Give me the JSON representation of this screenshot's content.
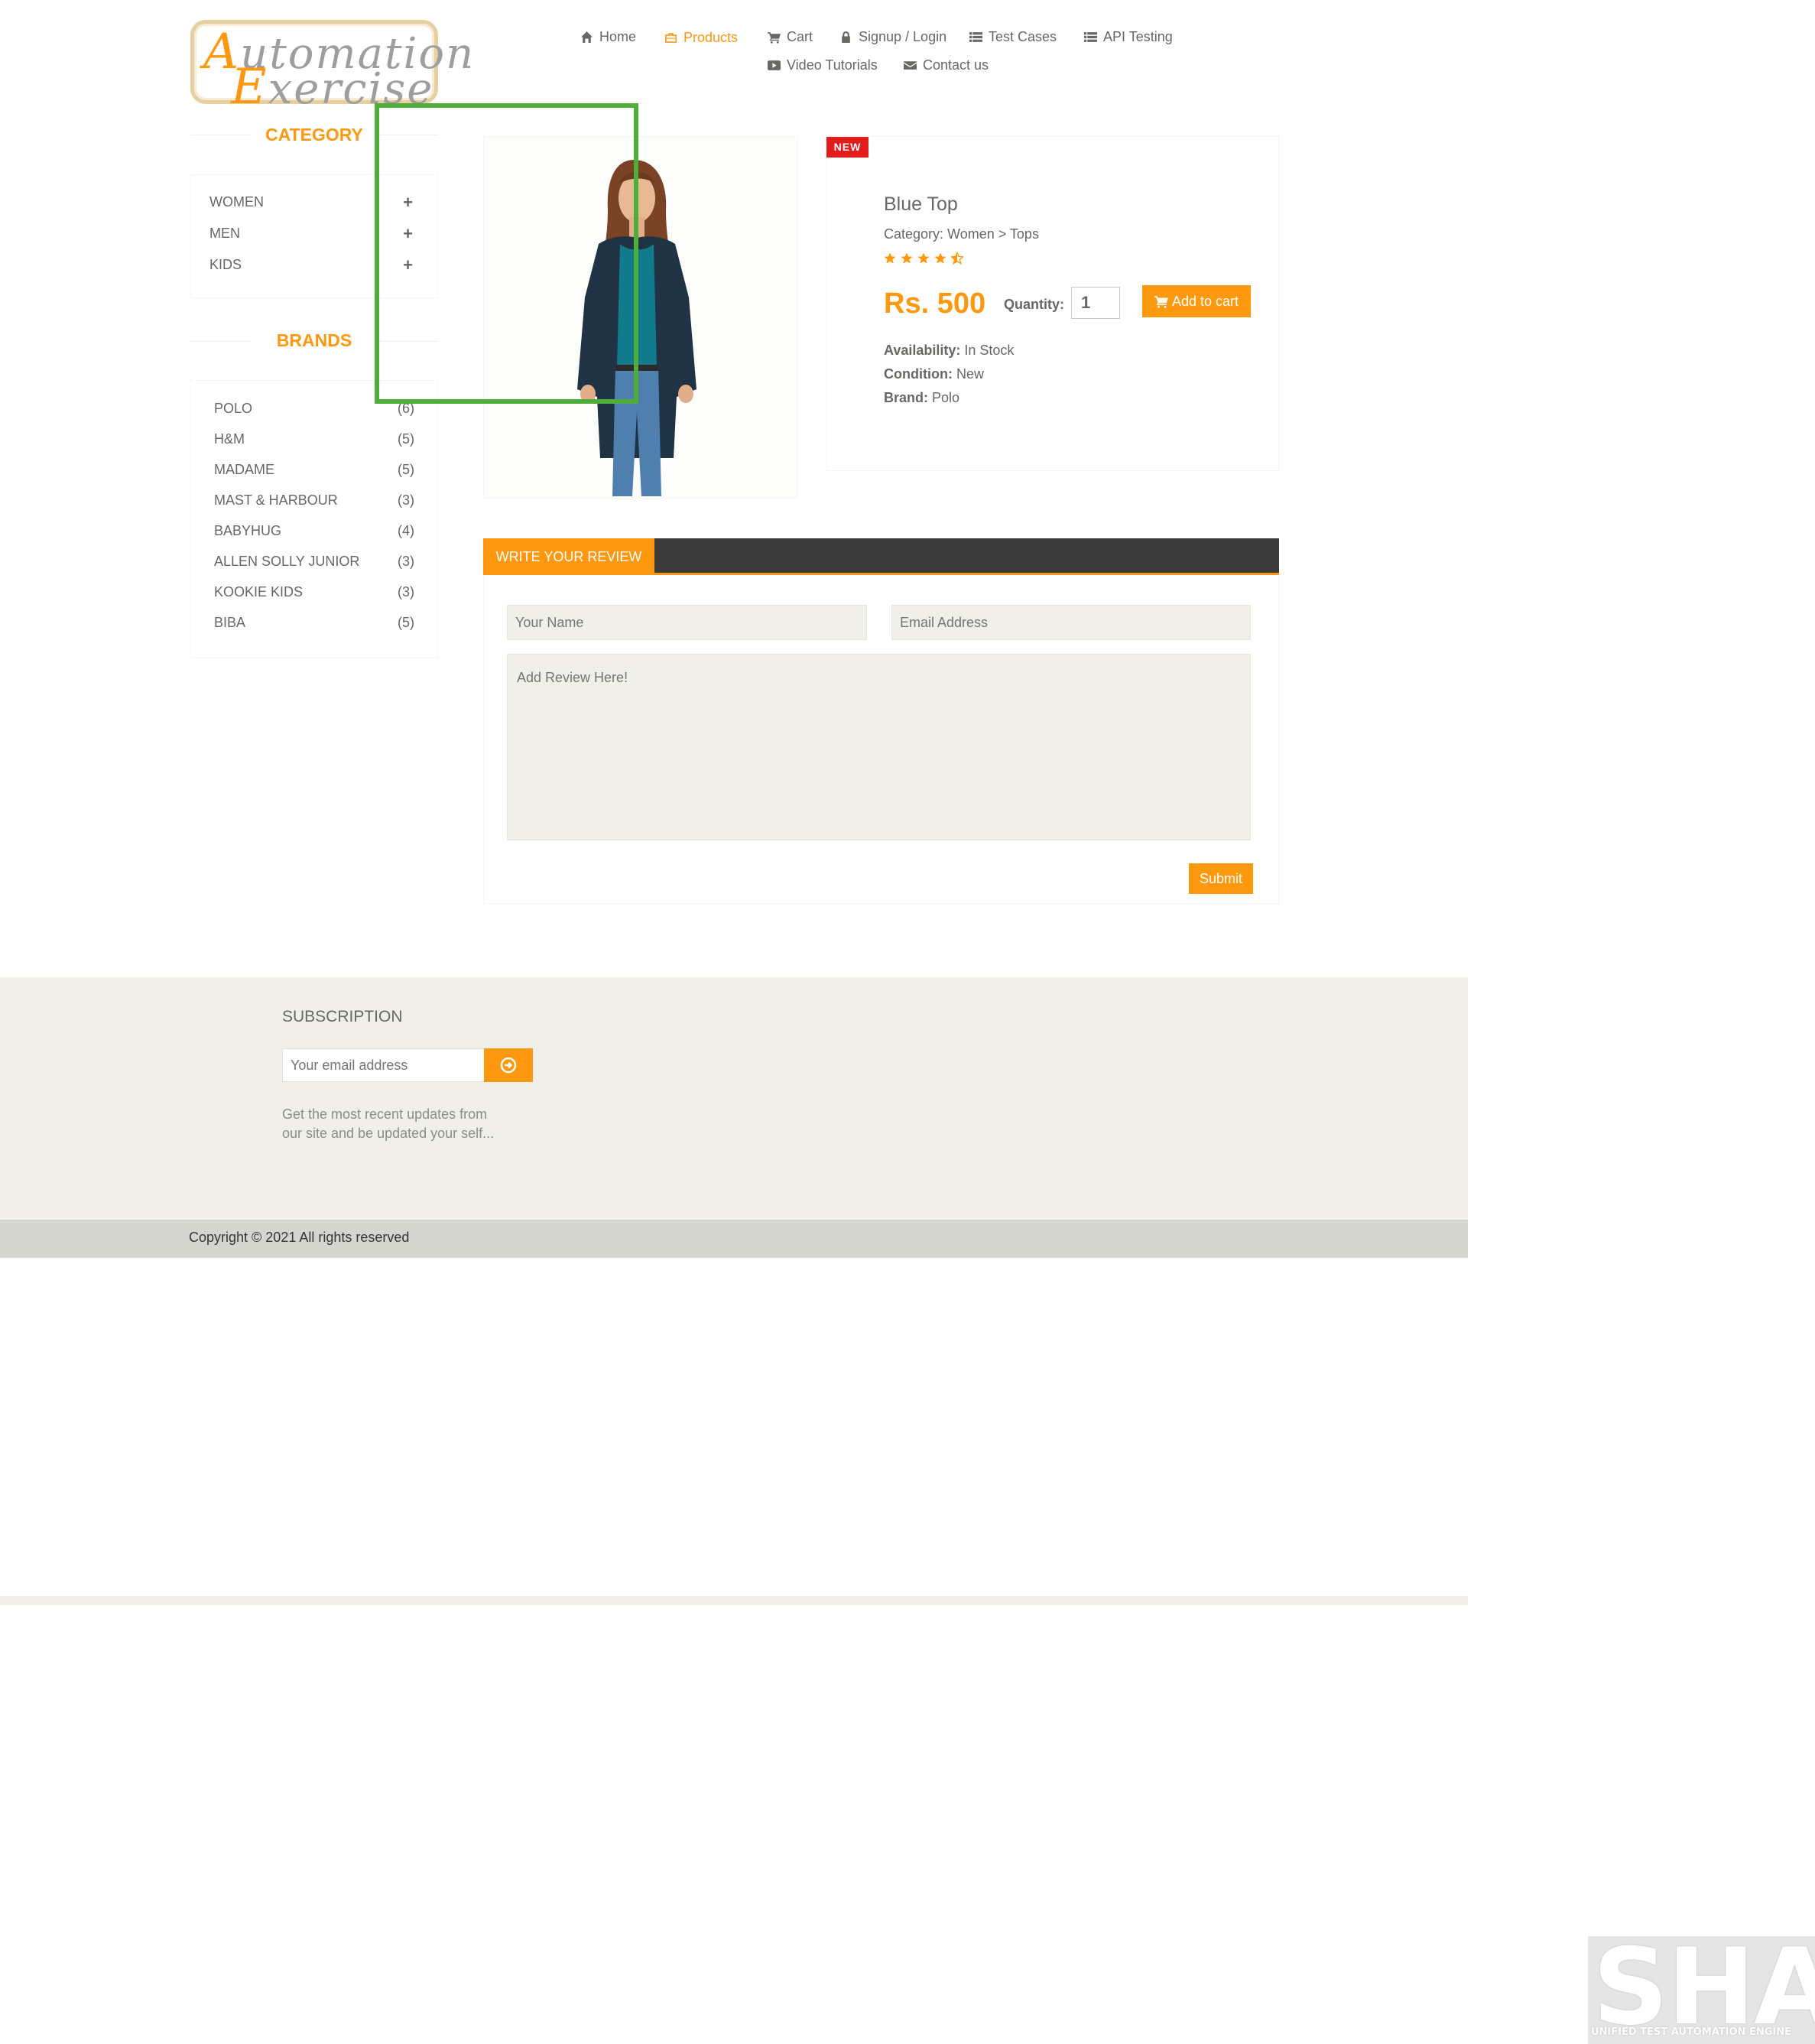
{
  "logo": {
    "line1_cap": "A",
    "line1_rest": "utomation",
    "line2_cap": "E",
    "line2_rest": "xercise"
  },
  "nav": {
    "home": "Home",
    "products": "Products",
    "cart": "Cart",
    "signup": "Signup / Login",
    "test_cases": "Test Cases",
    "api_testing": "API Testing",
    "video_tutorials": "Video Tutorials",
    "contact_us": "Contact us"
  },
  "sidebar": {
    "category_title": "CATEGORY",
    "categories": [
      {
        "label": "WOMEN",
        "toggle": "+"
      },
      {
        "label": "MEN",
        "toggle": "+"
      },
      {
        "label": "KIDS",
        "toggle": "+"
      }
    ],
    "brands_title": "BRANDS",
    "brands": [
      {
        "name": "POLO",
        "count": "(6)"
      },
      {
        "name": "H&M",
        "count": "(5)"
      },
      {
        "name": "MADAME",
        "count": "(5)"
      },
      {
        "name": "MAST & HARBOUR",
        "count": "(3)"
      },
      {
        "name": "BABYHUG",
        "count": "(4)"
      },
      {
        "name": "ALLEN SOLLY JUNIOR",
        "count": "(3)"
      },
      {
        "name": "KOOKIE KIDS",
        "count": "(3)"
      },
      {
        "name": "BIBA",
        "count": "(5)"
      }
    ]
  },
  "product": {
    "badge": "NEW",
    "name": "Blue Top",
    "category": "Category: Women > Tops",
    "rating": 4.5,
    "price": "Rs. 500",
    "quantity_label": "Quantity:",
    "quantity_value": "1",
    "add_to_cart": "Add to cart",
    "availability_label": "Availability:",
    "availability_value": "In Stock",
    "condition_label": "Condition:",
    "condition_value": "New",
    "brand_label": "Brand:",
    "brand_value": "Polo"
  },
  "review": {
    "tab_label": "WRITE YOUR REVIEW",
    "name_placeholder": "Your Name",
    "email_placeholder": "Email Address",
    "review_placeholder": "Add Review Here!",
    "submit": "Submit"
  },
  "footer": {
    "subscription_title": "SUBSCRIPTION",
    "email_placeholder": "Your email address",
    "subscription_text_1": "Get the most recent updates from",
    "subscription_text_2": "our site and be updated your self...",
    "copyright": "Copyright © 2021 All rights reserved"
  },
  "watermark": {
    "brand": "SHAFT",
    "tagline": "UNIFIED TEST AUTOMATION ENGINE"
  },
  "colors": {
    "accent": "#fe980f",
    "badge": "#e21b1b",
    "highlight": "#4fae3a",
    "footer_bg": "#f0f0e9",
    "dark_bar": "#3a3a3a"
  }
}
